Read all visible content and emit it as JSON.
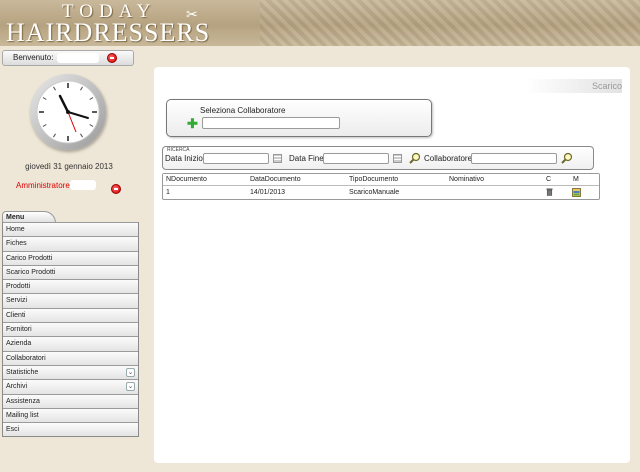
{
  "header": {
    "logo_top": "TODAY",
    "logo_bottom": "HAIRDRESSERS"
  },
  "welcome": {
    "label": "Benvenuto:"
  },
  "sidebar": {
    "date": "giovedì 31 gennaio 2013",
    "admin_label": "Amministratore :"
  },
  "menu": {
    "tab": "Menu",
    "items": [
      {
        "label": "Home"
      },
      {
        "label": "Fiches"
      },
      {
        "label": "Carico Prodotti"
      },
      {
        "label": "Scarico Prodotti"
      },
      {
        "label": "Prodotti"
      },
      {
        "label": "Servizi"
      },
      {
        "label": "Clienti"
      },
      {
        "label": "Fornitori"
      },
      {
        "label": "Azienda"
      },
      {
        "label": "Collaboratori"
      },
      {
        "label": "Statistiche",
        "expandable": true
      },
      {
        "label": "Archivi",
        "expandable": true
      },
      {
        "label": "Assistenza"
      },
      {
        "label": "Mailing list"
      },
      {
        "label": "Esci"
      }
    ]
  },
  "main": {
    "heading": "Scarico",
    "collab_select_label": "Seleziona Collaboratore",
    "search": {
      "legend": "RICERCA",
      "date_start_label": "Data Inizio",
      "date_end_label": "Data Fine",
      "collab_label": "Collaboratore"
    },
    "table": {
      "columns": [
        "NDocumento",
        "DataDocumento",
        "TipoDocumento",
        "Nominativo",
        "C",
        "M"
      ],
      "rows": [
        {
          "ndoc": "1",
          "date": "14/01/2013",
          "type": "ScaricoManuale",
          "name": ""
        }
      ]
    }
  },
  "colors": {
    "accent_red": "#dd0000",
    "add_green": "#33aa33",
    "background": "#eee6d6"
  }
}
